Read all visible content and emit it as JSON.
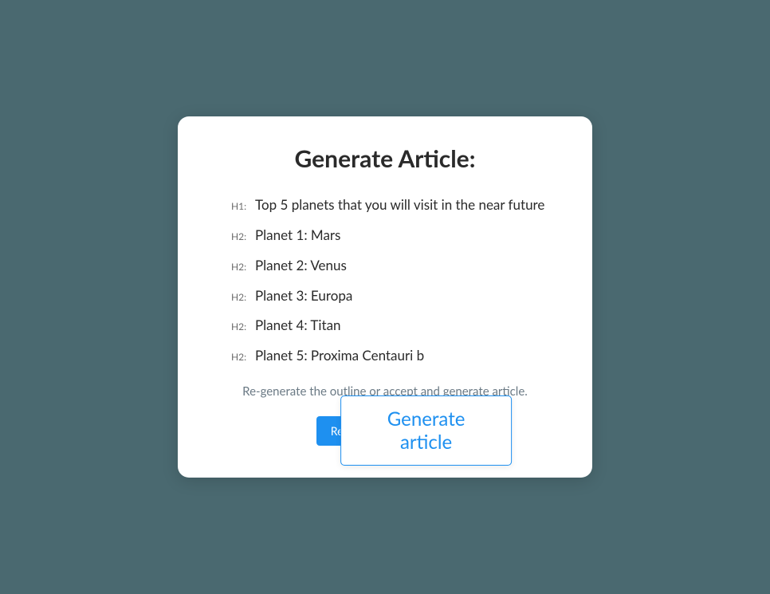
{
  "card": {
    "title": "Generate Article:",
    "instruction": "Re-generate the outline or accept and generate article."
  },
  "outline": [
    {
      "level": "H1:",
      "text": "Top 5 planets that you will visit in the near future"
    },
    {
      "level": "H2:",
      "text": "Planet 1: Mars"
    },
    {
      "level": "H2:",
      "text": "Planet 2: Venus"
    },
    {
      "level": "H2:",
      "text": "Planet 3: Europa"
    },
    {
      "level": "H2:",
      "text": "Planet 4: Titan"
    },
    {
      "level": "H2:",
      "text": "Planet 5: Proxima Centauri b"
    }
  ],
  "buttons": {
    "regenerate": "Re-generate headlines",
    "generate": "Generate article"
  }
}
